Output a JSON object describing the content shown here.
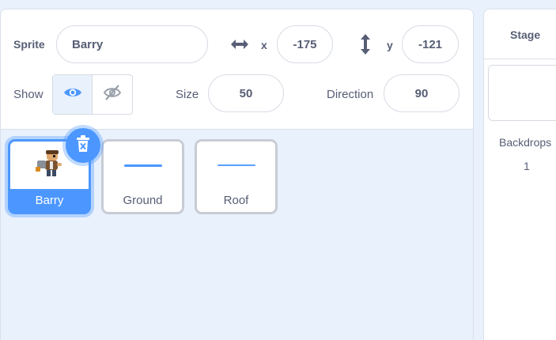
{
  "sprite_info": {
    "sprite_label": "Sprite",
    "sprite_name": "Barry",
    "x_label": "x",
    "x_value": "-175",
    "y_label": "y",
    "y_value": "-121",
    "show_label": "Show",
    "size_label": "Size",
    "size_value": "50",
    "direction_label": "Direction",
    "direction_value": "90",
    "show_visible_selected": true
  },
  "sprites": [
    {
      "name": "Barry",
      "selected": true,
      "icon": "character-costume-icon"
    },
    {
      "name": "Ground",
      "selected": false,
      "icon": "line-costume-icon"
    },
    {
      "name": "Roof",
      "selected": false,
      "icon": "line-costume-icon"
    }
  ],
  "stage": {
    "title": "Stage",
    "backdrops_label": "Backdrops",
    "backdrops_count": "1"
  },
  "colors": {
    "accent": "#4c97ff",
    "pane_background": "#e9f1fc",
    "text": "#575e75"
  }
}
